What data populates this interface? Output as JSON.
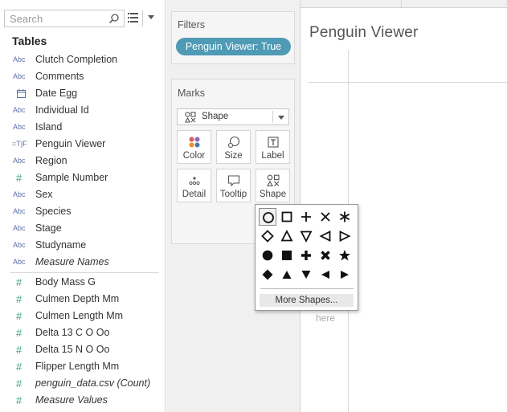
{
  "search": {
    "placeholder": "Search"
  },
  "data_pane": {
    "tables_title": "Tables",
    "dimensions": [
      {
        "type": "Abc",
        "icon": "string-type-icon",
        "name": "Clutch Completion",
        "italic": false
      },
      {
        "type": "Abc",
        "icon": "string-type-icon",
        "name": "Comments",
        "italic": false
      },
      {
        "type": "date",
        "icon": "calendar-icon",
        "name": "Date Egg",
        "italic": false
      },
      {
        "type": "Abc",
        "icon": "string-type-icon",
        "name": "Individual Id",
        "italic": false
      },
      {
        "type": "Abc",
        "icon": "string-type-icon",
        "name": "Island",
        "italic": false
      },
      {
        "type": "=T|F",
        "icon": "boolean-type-icon",
        "name": "Penguin Viewer",
        "italic": false
      },
      {
        "type": "Abc",
        "icon": "string-type-icon",
        "name": "Region",
        "italic": false
      },
      {
        "type": "#",
        "icon": "number-type-icon",
        "name": "Sample Number",
        "italic": false
      },
      {
        "type": "Abc",
        "icon": "string-type-icon",
        "name": "Sex",
        "italic": false
      },
      {
        "type": "Abc",
        "icon": "string-type-icon",
        "name": "Species",
        "italic": false
      },
      {
        "type": "Abc",
        "icon": "string-type-icon",
        "name": "Stage",
        "italic": false
      },
      {
        "type": "Abc",
        "icon": "string-type-icon",
        "name": "Studyname",
        "italic": false
      },
      {
        "type": "Abc",
        "icon": "string-type-icon",
        "name": "Measure Names",
        "italic": true
      }
    ],
    "measures": [
      {
        "type": "#",
        "icon": "number-type-icon",
        "name": "Body Mass G",
        "italic": false
      },
      {
        "type": "#",
        "icon": "number-type-icon",
        "name": "Culmen Depth Mm",
        "italic": false
      },
      {
        "type": "#",
        "icon": "number-type-icon",
        "name": "Culmen Length Mm",
        "italic": false
      },
      {
        "type": "#",
        "icon": "number-type-icon",
        "name": "Delta 13 C O Oo",
        "italic": false
      },
      {
        "type": "#",
        "icon": "number-type-icon",
        "name": "Delta 15 N O Oo",
        "italic": false
      },
      {
        "type": "#",
        "icon": "number-type-icon",
        "name": "Flipper Length Mm",
        "italic": false
      },
      {
        "type": "#",
        "icon": "number-type-icon",
        "name": "penguin_data.csv (Count)",
        "italic": true
      },
      {
        "type": "#",
        "icon": "number-type-icon",
        "name": "Measure Values",
        "italic": true
      }
    ]
  },
  "filters": {
    "title": "Filters",
    "pill": "Penguin Viewer: True"
  },
  "marks": {
    "title": "Marks",
    "mark_type": "Shape",
    "buttons": {
      "color": "Color",
      "size": "Size",
      "label": "Label",
      "detail": "Detail",
      "tooltip": "Tooltip",
      "shape": "Shape"
    }
  },
  "sheet": {
    "title": "Penguin Viewer",
    "drop_hint": "here"
  },
  "shape_palette": {
    "shapes": [
      "circle-outline",
      "square-outline",
      "plus",
      "cross",
      "asterisk",
      "diamond-outline",
      "triangle-up-outline",
      "triangle-down-outline",
      "triangle-left-outline",
      "triangle-right-outline",
      "circle-filled",
      "square-filled",
      "plus-filled",
      "cross-filled",
      "star-filled",
      "diamond-filled",
      "triangle-up-filled",
      "triangle-down-filled",
      "triangle-left-filled",
      "triangle-right-filled"
    ],
    "selected": "circle-outline",
    "more_label": "More Shapes..."
  },
  "colors": {
    "filter_pill": "#4f9ab5",
    "number_icon": "#3e9e8a",
    "string_icon": "#5a6fa8"
  }
}
